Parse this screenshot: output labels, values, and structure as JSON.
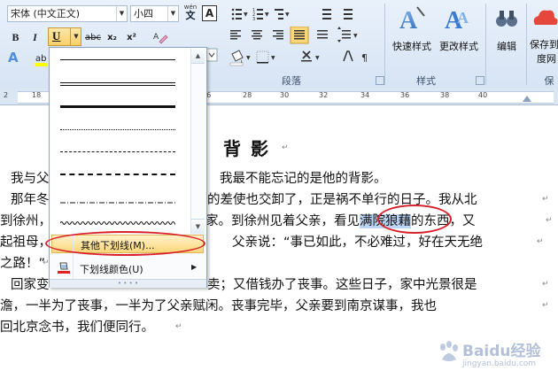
{
  "ribbon": {
    "font_name": "宋体 (中文正文)",
    "font_size": "小四",
    "phonetic": "wén",
    "border_char": "A",
    "bold": "B",
    "italic": "I",
    "underline": "U",
    "strike": "abc",
    "subscript": "x₂",
    "superscript": "x²",
    "groups": {
      "paragraph": "段落",
      "styles": "样式",
      "save_partial": "保存"
    },
    "quick_styles": "快速样式",
    "change_styles": "更改样式",
    "edit": "编辑",
    "save_to": "保存到",
    "save_to2": "度网"
  },
  "ruler": {
    "labels": [
      "2",
      "18",
      "20",
      "22",
      "24",
      "26",
      "28",
      "30",
      "32",
      "34",
      "36",
      "38",
      "40"
    ]
  },
  "menu": {
    "more_underlines": "其他下划线(M)...",
    "underline_color": "下划线颜色(U)"
  },
  "document": {
    "title": "背 影",
    "lines": [
      {
        "pre": "我与父",
        "text": "我最不能忘记的是他的背影。"
      },
      {
        "pre": "那年冬",
        "text": "的差使也交卸了，正是祸不单行的日子。我从北"
      },
      {
        "pre": "到徐州，",
        "text": "家。到徐州见着父亲，看见",
        "hl": "满院狼藉",
        "post": "的东西，又"
      },
      {
        "pre": "起祖母，",
        "text": "父亲说：“事已如此，不必难过，好在天无绝"
      },
      {
        "pre": "之路！”",
        "text": ""
      },
      {
        "pre": "回家变",
        "text": "卖；又借钱办了丧事。这些日子，家中光景很是"
      },
      {
        "pre": "",
        "text": "澹，一半为了丧事，一半为了父亲赋闲。丧事完毕，父亲要到南京谋事，我也"
      },
      {
        "pre": "",
        "text": "回北京念书，我们便同行。"
      }
    ]
  },
  "watermark": {
    "main": "Baidu经验",
    "sub": "jingyan.baidu.com"
  }
}
